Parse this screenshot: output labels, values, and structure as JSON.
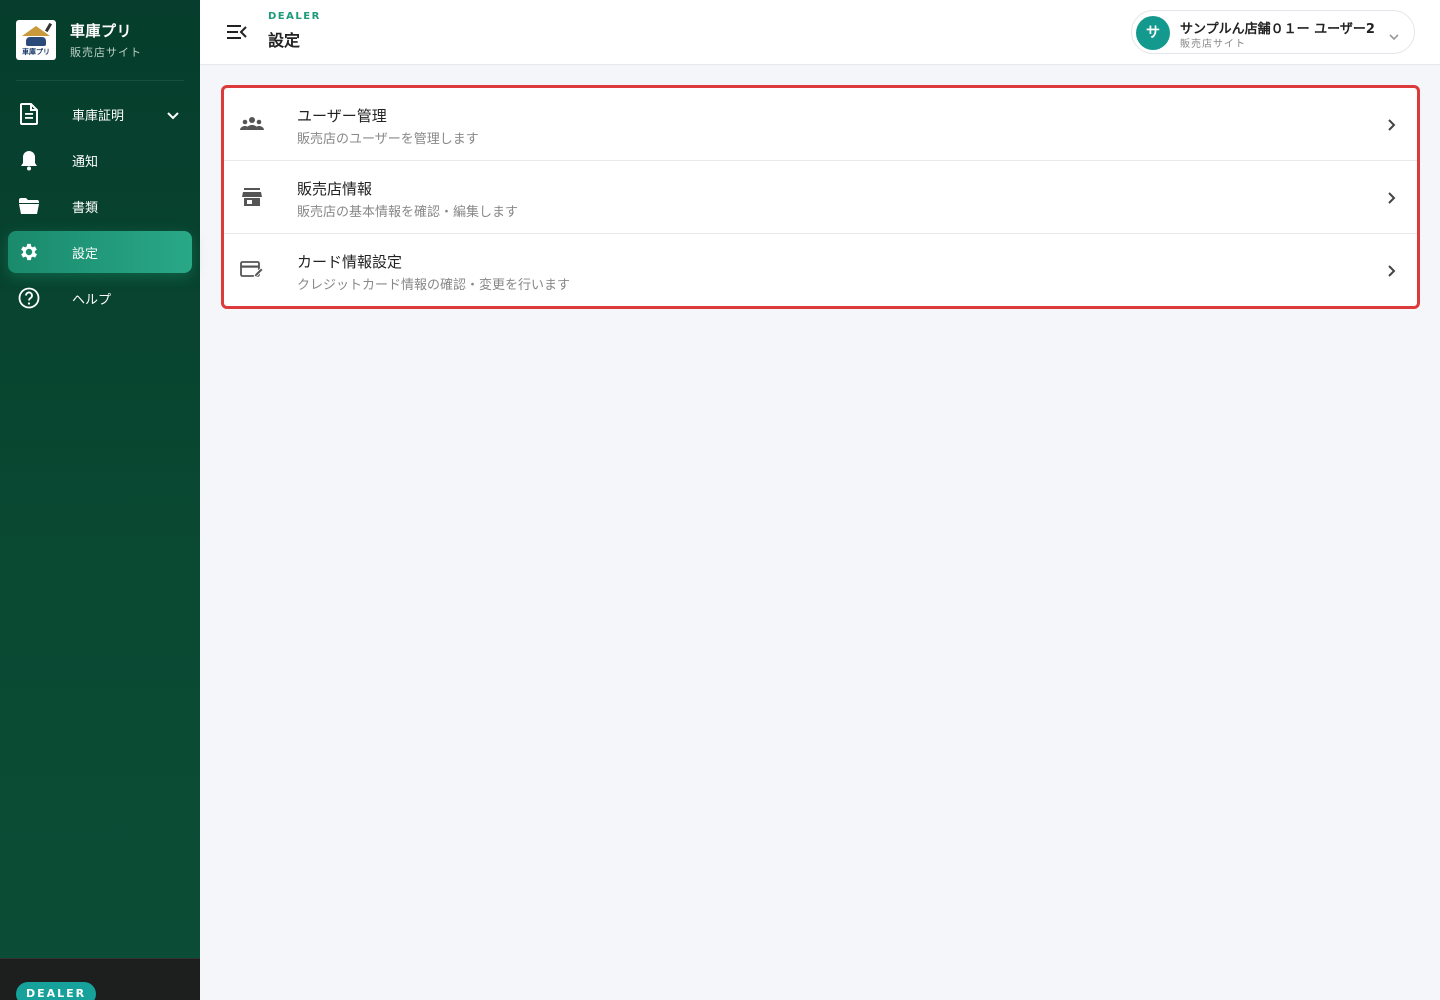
{
  "brand": {
    "title": "車庫プリ",
    "subtitle": "販売店サイト",
    "logo_text": "車庫プリ"
  },
  "nav": {
    "items": [
      {
        "label": "車庫証明",
        "icon": "document-icon",
        "has_children": true
      },
      {
        "label": "通知",
        "icon": "bell-icon"
      },
      {
        "label": "書類",
        "icon": "folder-icon"
      },
      {
        "label": "設定",
        "icon": "gear-icon",
        "active": true
      },
      {
        "label": "ヘルプ",
        "icon": "help-circle-icon"
      }
    ]
  },
  "footer": {
    "badge": "DEALER"
  },
  "header": {
    "eyebrow": "DEALER",
    "title": "設定",
    "user": {
      "avatar_initial": "サ",
      "name": "サンプルん店舗０１ー ユーザー2",
      "role": "販売店サイト"
    }
  },
  "settings": {
    "rows": [
      {
        "title": "ユーザー管理",
        "description": "販売店のユーザーを管理します",
        "icon": "users-icon"
      },
      {
        "title": "販売店情報",
        "description": "販売店の基本情報を確認・編集します",
        "icon": "store-icon"
      },
      {
        "title": "カード情報設定",
        "description": "クレジットカード情報の確認・変更を行います",
        "icon": "card-edit-icon"
      }
    ]
  },
  "colors": {
    "sidebar_bg": "#063d2c",
    "accent": "#1b9a7c",
    "active_nav": "#29a888",
    "highlight_border": "#dd3b3b",
    "avatar": "#14998f"
  }
}
